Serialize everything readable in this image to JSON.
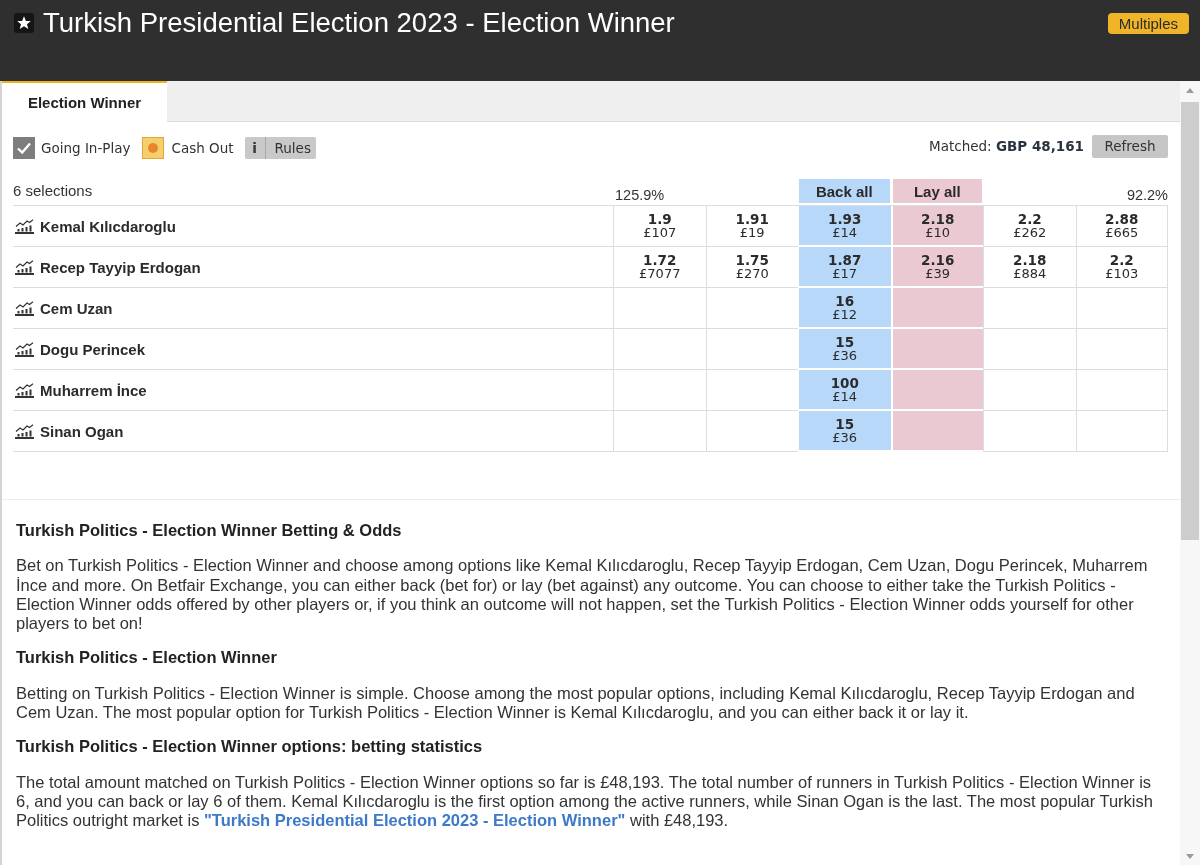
{
  "header": {
    "title": "Turkish Presidential Election 2023 - Election Winner",
    "multiples_button": "Multiples"
  },
  "tabs": [
    {
      "label": "Election Winner",
      "selected": true
    }
  ],
  "controls": {
    "going_in_play": {
      "label": "Going In-Play",
      "checked": true
    },
    "cash_out": {
      "label": "Cash Out",
      "on": true
    },
    "rules_button": {
      "icon_text": "i",
      "label": "Rules"
    },
    "matched": "Matched: **GBP 48,161**",
    "refresh_button": "Refresh"
  },
  "market": {
    "selections": "6 selections",
    "back_percentage": "125.9%",
    "back_all_button": "Back all",
    "lay_all_button": "Lay all",
    "lay_percentage": "92.2%",
    "runners": [
      {
        "name": "Kemal Kılıcdaroglu",
        "back": [
          {
            "price": "1.9",
            "size": "£107"
          },
          {
            "price": "1.91",
            "size": "£19"
          },
          {
            "price": "1.93",
            "size": "£14"
          }
        ],
        "lay": [
          {
            "price": "2.18",
            "size": "£10"
          },
          {
            "price": "2.2",
            "size": "£262"
          },
          {
            "price": "2.88",
            "size": "£665"
          }
        ]
      },
      {
        "name": "Recep Tayyip Erdogan",
        "back": [
          {
            "price": "1.72",
            "size": "£7077"
          },
          {
            "price": "1.75",
            "size": "£270"
          },
          {
            "price": "1.87",
            "size": "£17"
          }
        ],
        "lay": [
          {
            "price": "2.16",
            "size": "£39"
          },
          {
            "price": "2.18",
            "size": "£884"
          },
          {
            "price": "2.2",
            "size": "£103"
          }
        ]
      },
      {
        "name": "Cem Uzan",
        "back": [
          {
            "price": "16",
            "size": "£12"
          }
        ]
      },
      {
        "name": "Dogu Perincek",
        "back": [
          {
            "price": "15",
            "size": "£36"
          }
        ]
      },
      {
        "name": "Muharrem İnce",
        "back": [
          {
            "price": "100",
            "size": "£14"
          }
        ]
      },
      {
        "name": "Sinan Ogan",
        "back": [
          {
            "price": "15",
            "size": "£36"
          }
        ]
      }
    ]
  },
  "description": [
    {
      "kind": "heading",
      "text": "Turkish Politics - Election Winner Betting & Odds"
    },
    {
      "kind": "paragraph",
      "parts": [
        {
          "kind": "text",
          "text": "Bet on Turkish Politics - Election Winner and choose among options like Kemal Kılıcdaroglu, Recep Tayyip Erdogan, Cem Uzan, Dogu Perincek, Muharrem İnce and more. On Betfair Exchange, you can either back (bet for) or lay (bet against) any outcome. You can choose to either take the Turkish Politics - Election Winner odds offered by other players or, if you think an outcome will not happen, set the Turkish Politics - Election Winner odds yourself for other players to bet on!"
        }
      ]
    },
    {
      "kind": "heading",
      "text": "Turkish Politics - Election Winner"
    },
    {
      "kind": "paragraph",
      "parts": [
        {
          "kind": "text",
          "text": "Betting on Turkish Politics - Election Winner is simple. Choose among the most popular options, including Kemal Kılıcdaroglu, Recep Tayyip Erdogan and Cem Uzan. The most popular option for Turkish Politics - Election Winner is Kemal Kılıcdaroglu, and you can either back it or lay it."
        }
      ]
    },
    {
      "kind": "heading",
      "text": "Turkish Politics - Election Winner options: betting statistics"
    },
    {
      "kind": "paragraph",
      "parts": [
        {
          "kind": "text",
          "text": "The total amount matched on Turkish Politics - Election Winner options so far is £48,193. The total number of runners in Turkish Politics - Election Winner is 6, and you can back or lay 6 of them. Kemal Kılıcdaroglu is the first option among the active runners, while Sinan Ogan is the last. The most popular Turkish Politics outright market is "
        },
        {
          "kind": "link",
          "text": "\"Turkish Presidential Election 2023 - Election Winner\""
        },
        {
          "kind": "text",
          "text": " with £48,193."
        }
      ]
    }
  ]
}
